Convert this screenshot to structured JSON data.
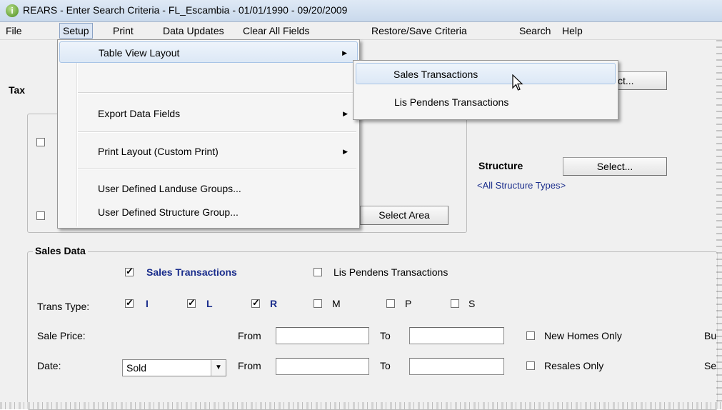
{
  "window": {
    "title": "REARS - Enter Search Criteria - FL_Escambia - 01/01/1990 - 09/20/2009",
    "icon": "info-icon"
  },
  "menubar": {
    "items": [
      "File",
      "Setup",
      "Print",
      "Data Updates",
      "Clear All Fields",
      "Restore/Save Criteria",
      "Search",
      "Help"
    ]
  },
  "setup_menu": {
    "items": [
      {
        "label": "Table View Layout",
        "has_submenu": true
      },
      {
        "label": "Export Data Fields",
        "has_submenu": true
      },
      {
        "label": "Print Layout (Custom Print)",
        "has_submenu": true
      },
      {
        "label": "User Defined Landuse Groups..."
      },
      {
        "label": "User Defined Structure Group..."
      }
    ],
    "submenu_arrow": "▶"
  },
  "table_view_submenu": {
    "items": [
      "Sales Transactions",
      "Lis Pendens Transactions"
    ]
  },
  "tax_section": {
    "label_partial": "Tax",
    "select_button_partial": "ct...",
    "select_area_button": "Select Area"
  },
  "structure": {
    "label": "Structure",
    "select_button": "Select...",
    "value": "<All Structure Types>"
  },
  "sales_data": {
    "title": "Sales Data",
    "sales_transactions": {
      "label": "Sales Transactions",
      "checked": true
    },
    "lis_pendens": {
      "label": "Lis Pendens Transactions",
      "checked": false
    },
    "trans_type": {
      "label": "Trans Type:",
      "types": [
        {
          "code": "I",
          "checked": true
        },
        {
          "code": "L",
          "checked": true
        },
        {
          "code": "R",
          "checked": true
        },
        {
          "code": "M",
          "checked": false
        },
        {
          "code": "P",
          "checked": false
        },
        {
          "code": "S",
          "checked": false
        }
      ]
    },
    "sale_price": {
      "label": "Sale Price:",
      "from_label": "From",
      "from_value": "",
      "to_label": "To",
      "to_value": ""
    },
    "date": {
      "label": "Date:",
      "selected": "Sold",
      "from_label": "From",
      "from_value": "",
      "to_label": "To",
      "to_value": ""
    },
    "new_homes_only": {
      "label": "New Homes Only",
      "checked": false
    },
    "resales_only": {
      "label": "Resales Only",
      "checked": false
    },
    "right_partial_1": "Bu",
    "right_partial_2": "Se"
  }
}
